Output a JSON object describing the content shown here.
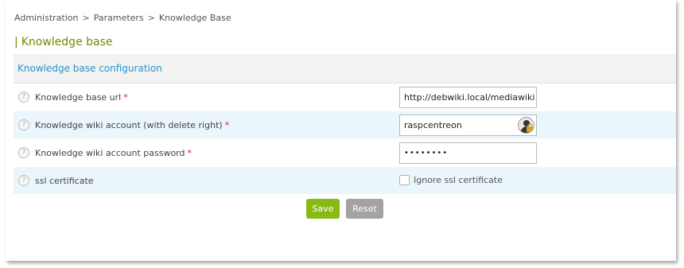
{
  "breadcrumb": {
    "items": [
      "Administration",
      "Parameters",
      "Knowledge Base"
    ],
    "separator": ">"
  },
  "page": {
    "title_bar": "|",
    "title": "Knowledge base"
  },
  "section": {
    "title": "Knowledge base configuration"
  },
  "help_icon": "?",
  "required_marker": "*",
  "fields": {
    "url": {
      "label": "Knowledge base url",
      "value": "http://debwiki.local/mediawiki"
    },
    "account": {
      "label": "Knowledge wiki account (with delete right)",
      "value": "raspcentreon",
      "icon": "user-lock-icon"
    },
    "password": {
      "label": "Knowledge wiki account password",
      "value": "••••••••"
    },
    "ssl": {
      "label": "ssl certificate",
      "checkbox_label": "Ignore ssl certificate",
      "checked": false
    }
  },
  "buttons": {
    "save": "Save",
    "reset": "Reset"
  },
  "colors": {
    "title": "#6b8e00",
    "section_title": "#2a95c9",
    "required": "#d21f1f",
    "save_button": "#88b917",
    "reset_button": "#a3a3a3",
    "even_row": "#eaf6fc"
  }
}
